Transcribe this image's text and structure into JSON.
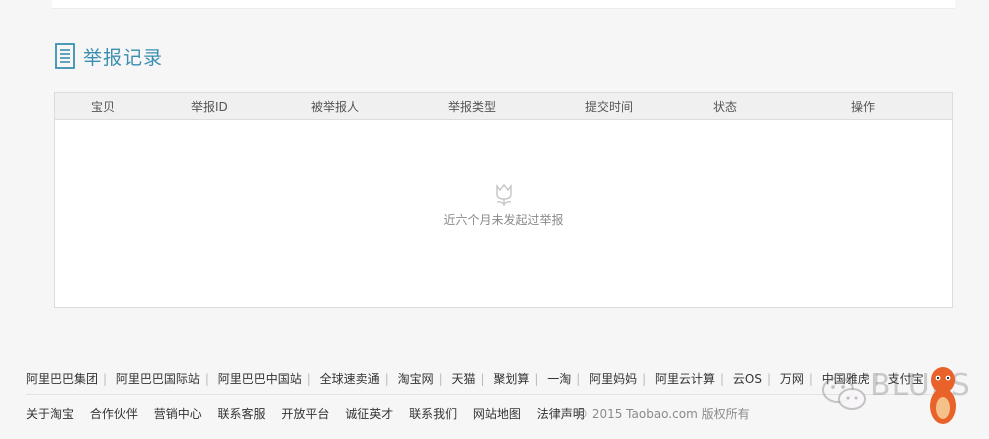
{
  "section": {
    "title": "举报记录"
  },
  "table": {
    "columns": [
      "宝贝",
      "举报ID",
      "被举报人",
      "举报类型",
      "提交时间",
      "状态",
      "操作"
    ],
    "empty_text": "近六个月未发起过举报"
  },
  "footer": {
    "links": [
      "阿里巴巴集团",
      "阿里巴巴国际站",
      "阿里巴巴中国站",
      "全球速卖通",
      "淘宝网",
      "天猫",
      "聚划算",
      "一淘",
      "阿里妈妈",
      "阿里云计算",
      "云OS",
      "万网",
      "中国雅虎",
      "支付宝"
    ],
    "bottom_links": [
      "关于淘宝",
      "合作伙伴",
      "营销中心",
      "联系客服",
      "开放平台",
      "诚征英才",
      "联系我们",
      "网站地图",
      "法律声明"
    ],
    "copyright": "© 2015 Taobao.com 版权所有"
  },
  "watermark": {
    "text": "BLUES"
  },
  "colors": {
    "accent": "#3a8fb0",
    "muted": "#8a8a8a"
  },
  "icons": {
    "title_icon": "document-icon",
    "empty_icon": "tulip-icon"
  }
}
